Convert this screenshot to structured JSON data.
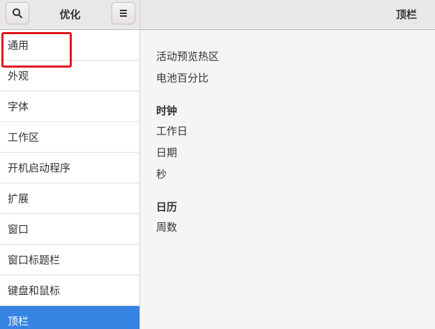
{
  "header": {
    "sidebar_title": "优化",
    "page_title": "顶栏"
  },
  "icons": {
    "search": "search-icon",
    "menu": "hamburger-menu-icon"
  },
  "sidebar": {
    "items": [
      {
        "label": "通用"
      },
      {
        "label": "外观"
      },
      {
        "label": "字体"
      },
      {
        "label": "工作区"
      },
      {
        "label": "开机启动程序"
      },
      {
        "label": "扩展"
      },
      {
        "label": "窗口"
      },
      {
        "label": "窗口标题栏"
      },
      {
        "label": "键盘和鼠标"
      },
      {
        "label": "顶栏"
      }
    ],
    "selected_label": "顶栏",
    "highlighted_label": "通用"
  },
  "main": {
    "items": {
      "hot_corner": "活动预览热区",
      "battery_percent": "电池百分比"
    },
    "clock": {
      "title": "时钟",
      "weekday": "工作日",
      "date": "日期",
      "seconds": "秒"
    },
    "calendar": {
      "title": "日历",
      "week_numbers": "周数"
    }
  },
  "colors": {
    "accent": "#3584e4",
    "highlight_box": "#e0151b"
  }
}
